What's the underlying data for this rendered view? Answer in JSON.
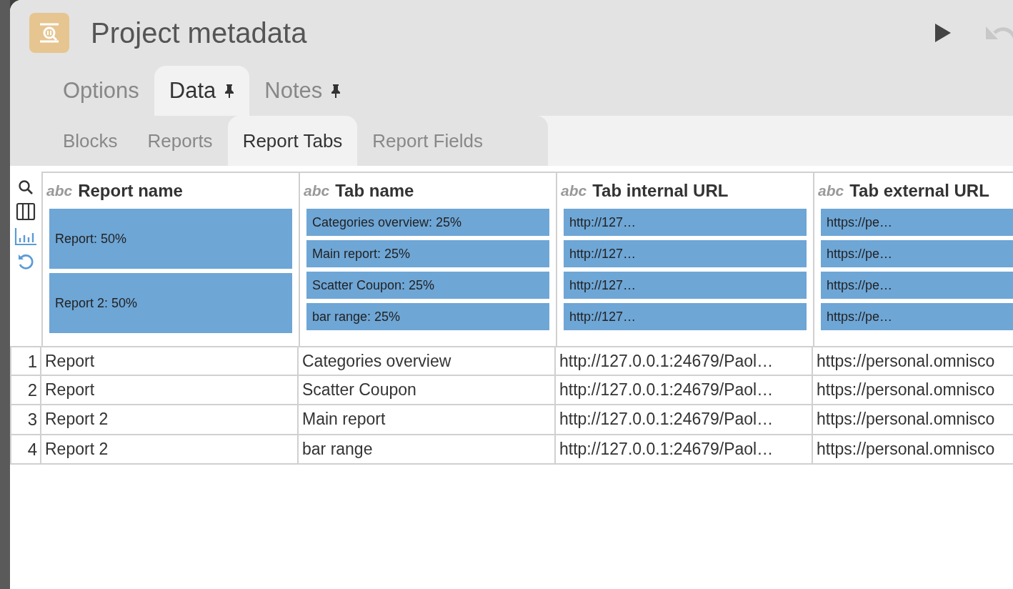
{
  "window": {
    "title": "Project metadata"
  },
  "toolbar": [
    {
      "kind": "run",
      "disabled": false
    },
    {
      "kind": "undo",
      "disabled": true
    }
  ],
  "tabs": [
    {
      "label": "Options",
      "selected": false,
      "pinned": false
    },
    {
      "label": "Data",
      "selected": true,
      "pinned": true
    },
    {
      "label": "Notes",
      "selected": false,
      "pinned": true
    }
  ],
  "subtabs": [
    {
      "label": "Blocks",
      "selected": false
    },
    {
      "label": "Reports",
      "selected": false
    },
    {
      "label": "Report Tabs",
      "selected": true
    },
    {
      "label": "Report Fields",
      "selected": false
    }
  ],
  "side_tools": [
    {
      "kind": "search",
      "active": false
    },
    {
      "kind": "columns",
      "active": false
    },
    {
      "kind": "chart",
      "active": true
    },
    {
      "kind": "revert",
      "active": true
    }
  ],
  "table": {
    "columns": [
      {
        "type": "abc",
        "name": "Report name",
        "summary": [
          "Report: 50%",
          "Report 2: 50%"
        ]
      },
      {
        "type": "abc",
        "name": "Tab name",
        "summary": [
          "Categories overview: 25%",
          "Main report: 25%",
          "Scatter Coupon: 25%",
          "bar range: 25%"
        ]
      },
      {
        "type": "abc",
        "name": "Tab internal URL",
        "summary": [
          "http://127…",
          "http://127…",
          "http://127…",
          "http://127…"
        ]
      },
      {
        "type": "abc",
        "name": "Tab external URL",
        "summary": [
          "https://pe…",
          "https://pe…",
          "https://pe…",
          "https://pe…"
        ]
      }
    ],
    "rows": [
      {
        "number": "1",
        "cells": [
          "Report",
          "Categories overview",
          "http://127.0.0.1:24679/Paol…",
          "https://personal.omnisco"
        ]
      },
      {
        "number": "2",
        "cells": [
          "Report",
          "Scatter Coupon",
          "http://127.0.0.1:24679/Paol…",
          "https://personal.omnisco"
        ]
      },
      {
        "number": "3",
        "cells": [
          "Report 2",
          "Main report",
          "http://127.0.0.1:24679/Paol…",
          "https://personal.omnisco"
        ]
      },
      {
        "number": "4",
        "cells": [
          "Report 2",
          "bar range",
          "http://127.0.0.1:24679/Paol…",
          "https://personal.omnisco"
        ]
      }
    ]
  }
}
